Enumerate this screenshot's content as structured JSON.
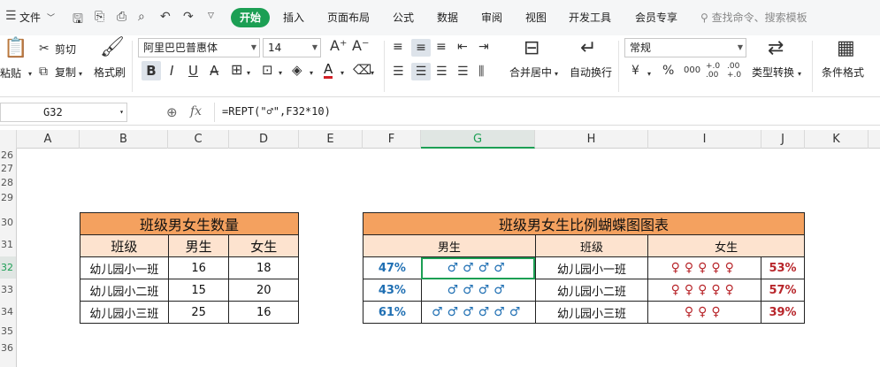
{
  "menubar": {
    "file_label": "文件",
    "tabs": [
      "开始",
      "插入",
      "页面布局",
      "公式",
      "数据",
      "审阅",
      "视图",
      "开发工具",
      "会员专享"
    ],
    "search_placeholder": "查找命令、搜索模板"
  },
  "ribbon": {
    "paste": "粘贴",
    "cut": "剪切",
    "copy": "复制",
    "format_painter": "格式刷",
    "font_name": "阿里巴巴普惠体",
    "font_size": "14",
    "bold": "B",
    "italic": "I",
    "underline": "U",
    "merge_center": "合并居中",
    "wrap_text": "自动换行",
    "number_format": "常规",
    "currency": "¥",
    "percent": "%",
    "thousands": "000",
    "inc_decimal": "+.0 .00",
    "dec_decimal": ".00 +.0",
    "type_convert": "类型转换",
    "cond_format": "条件格式"
  },
  "formula_bar": {
    "cell_ref": "G32",
    "fx": "fx",
    "formula": "=REPT(\"♂\",F32*10)"
  },
  "columns": [
    "A",
    "B",
    "C",
    "D",
    "E",
    "F",
    "G",
    "H",
    "I",
    "J",
    "K"
  ],
  "rows": [
    "26",
    "27",
    "28",
    "29",
    "30",
    "31",
    "32",
    "33",
    "34",
    "35",
    "36"
  ],
  "active_cell": {
    "column": "G",
    "row": "32"
  },
  "table1": {
    "title": "班级男女生数量",
    "headers": [
      "班级",
      "男生",
      "女生"
    ],
    "rows": [
      {
        "class": "幼儿园小一班",
        "boys": "16",
        "girls": "18"
      },
      {
        "class": "幼儿园小二班",
        "boys": "15",
        "girls": "20"
      },
      {
        "class": "幼儿园小三班",
        "boys": "25",
        "girls": "16"
      }
    ]
  },
  "table2": {
    "title": "班级男女生比例蝴蝶图图表",
    "headers": [
      "男生",
      "班级",
      "女生"
    ],
    "rows": [
      {
        "boy_pct": "47%",
        "boy_sym": "♂♂♂♂",
        "class": "幼儿园小一班",
        "girl_sym": "♀♀♀♀♀",
        "girl_pct": "53%"
      },
      {
        "boy_pct": "43%",
        "boy_sym": "♂♂♂♂",
        "class": "幼儿园小二班",
        "girl_sym": "♀♀♀♀♀",
        "girl_pct": "57%"
      },
      {
        "boy_pct": "61%",
        "boy_sym": "♂♂♂♂♂♂",
        "class": "幼儿园小三班",
        "girl_sym": "♀♀♀",
        "girl_pct": "39%"
      }
    ]
  }
}
